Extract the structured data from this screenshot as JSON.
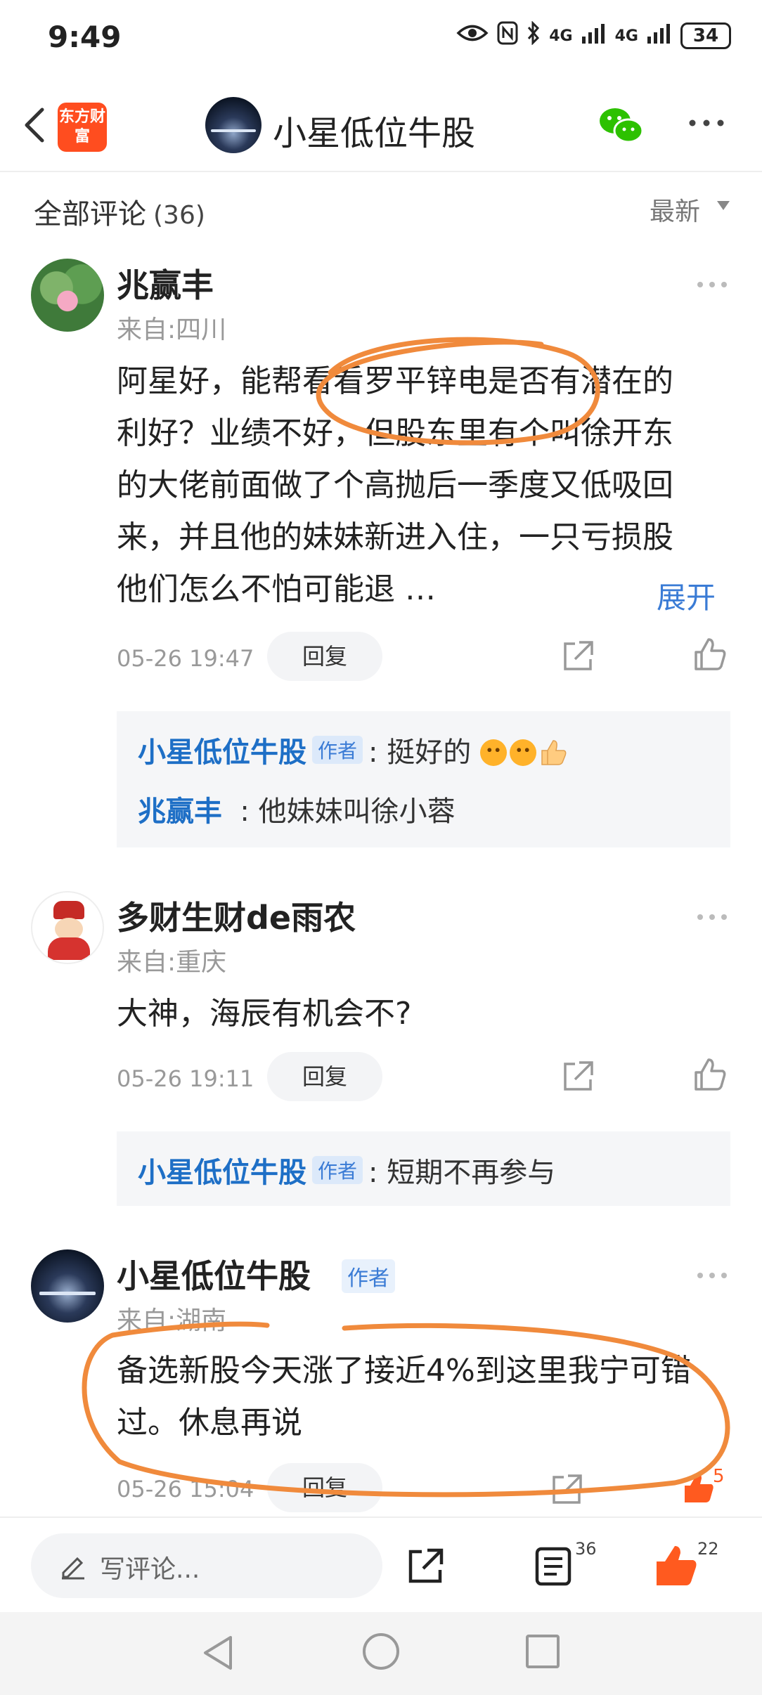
{
  "status_bar": {
    "time": "9:49",
    "icons": [
      "eye-icon",
      "nfc-icon",
      "bluetooth-icon",
      "signal-4g-icon",
      "signal-4g-icon"
    ],
    "network_1": "4G",
    "network_2": "4G",
    "battery": "34"
  },
  "header": {
    "app_logo_text": "东方财富",
    "title": "小星低位牛股"
  },
  "comments_header": {
    "title": "全部评论",
    "count": "(36)",
    "sort": "最新"
  },
  "comments": [
    {
      "username": "兆赢丰",
      "location": "来自:四川",
      "text": "阿星好，能帮看看罗平锌电是否有潜在的利好？业绩不好，但股东里有个叫徐开东的大佬前面做了个高抛后一季度又低吸回来，并且他的妹妹新进入住，一只亏损股他们怎么不怕可能退 …",
      "expand": "展开",
      "time": "05-26 19:47",
      "reply_label": "回复",
      "replies": [
        {
          "user": "小星低位牛股",
          "tag": "作者",
          "text": "挺好的"
        },
        {
          "user": "兆赢丰",
          "text": "他妹妹叫徐小蓉"
        }
      ]
    },
    {
      "username": "多财生财de雨农",
      "location": "来自:重庆",
      "text": "大神，海辰有机会不?",
      "time": "05-26 19:11",
      "reply_label": "回复",
      "replies": [
        {
          "user": "小星低位牛股",
          "tag": "作者",
          "text": "短期不再参与"
        }
      ]
    },
    {
      "username": "小星低位牛股",
      "tag": "作者",
      "location": "来自:湖南",
      "text": "备选新股今天涨了接近4%到这里我宁可错过。休息再说",
      "time": "05-26 15:04",
      "reply_label": "回复",
      "likes": "5"
    }
  ],
  "bottom_bar": {
    "input_placeholder": "写评论...",
    "comment_count": "36",
    "like_count": "22"
  },
  "colors": {
    "accent_blue": "#3a7bd5",
    "reply_user_blue": "#1e6fc6",
    "like_orange": "#ff5a1f",
    "annotation_orange": "#f08a3c"
  }
}
